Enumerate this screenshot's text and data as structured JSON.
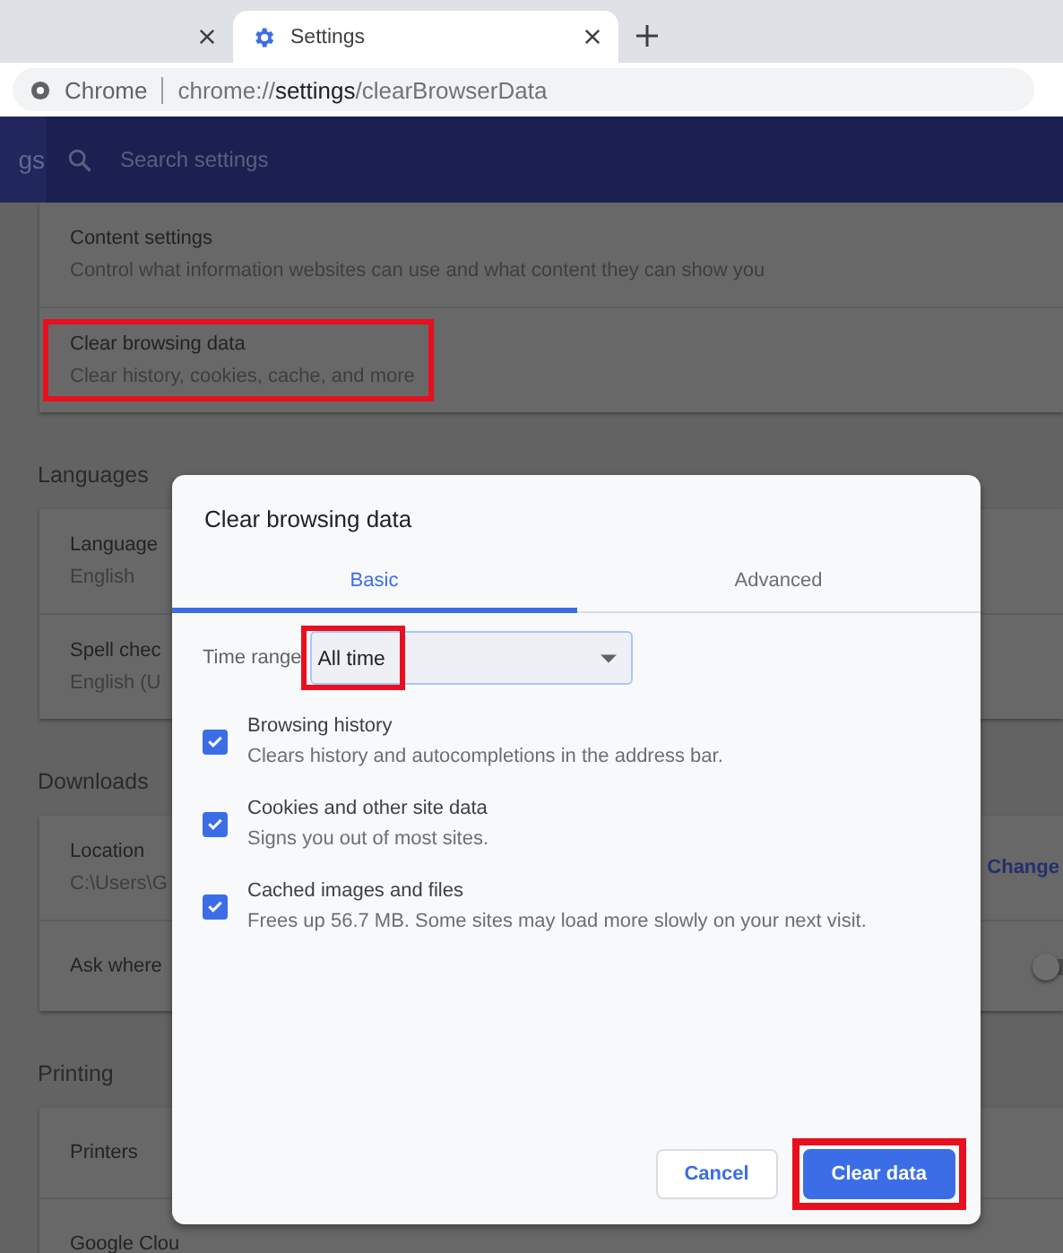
{
  "browser": {
    "tabs": [
      {
        "selected": false
      },
      {
        "label": "Settings",
        "selected": true
      }
    ],
    "address": {
      "site_label": "Chrome",
      "url_scheme": "chrome://",
      "url_host": "settings",
      "url_path": "/clearBrowserData"
    }
  },
  "header": {
    "title": "gs",
    "search_placeholder": "Search settings"
  },
  "sections": [
    {
      "items": [
        {
          "title": "Content settings",
          "subtitle": "Control what information websites can use and what content they can show you"
        },
        {
          "title": "Clear browsing data",
          "subtitle": "Clear history, cookies, cache, and more",
          "highlighted": true
        }
      ]
    },
    {
      "heading": "Languages",
      "items": [
        {
          "title": "Language",
          "subtitle": "English"
        },
        {
          "title": "Spell chec",
          "subtitle": "English (U"
        }
      ]
    },
    {
      "heading": "Downloads",
      "items": [
        {
          "title": "Location",
          "subtitle": "C:\\Users\\G",
          "action": "Change"
        },
        {
          "title": "Ask where",
          "kind": "toggle",
          "on": false
        }
      ]
    },
    {
      "heading": "Printing",
      "items": [
        {
          "title": "Printers"
        },
        {
          "title": "Google Clou"
        }
      ]
    }
  ],
  "dialog": {
    "title": "Clear browsing data",
    "tabs": [
      {
        "label": "Basic",
        "selected": true
      },
      {
        "label": "Advanced",
        "selected": false
      }
    ],
    "time_range": {
      "label": "Time range",
      "value": "All time",
      "highlighted": true
    },
    "options": [
      {
        "title": "Browsing history",
        "description": "Clears history and autocompletions in the address bar.",
        "checked": true
      },
      {
        "title": "Cookies and other site data",
        "description": "Signs you out of most sites.",
        "checked": true
      },
      {
        "title": "Cached images and files",
        "description": "Frees up 56.7 MB. Some sites may load more slowly on your next visit.",
        "checked": true
      }
    ],
    "buttons": [
      {
        "label": "Cancel",
        "kind": "secondary"
      },
      {
        "label": "Clear data",
        "kind": "primary",
        "highlighted": true
      }
    ]
  }
}
